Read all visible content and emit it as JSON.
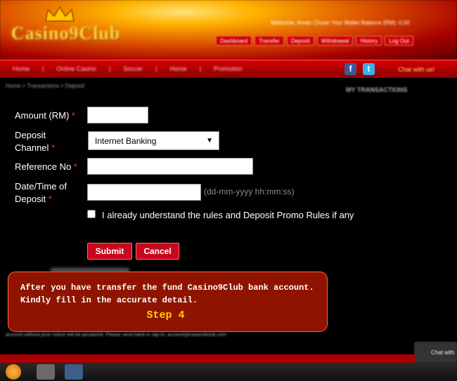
{
  "header": {
    "logo_text": "Casino9Club",
    "welcome": "Welcome, Aman Chuan   Your Wallet Balance (RM): 0.00",
    "buttons": [
      "Dashboard",
      "Transfer",
      "Deposit",
      "Withdrawal",
      "History",
      "Log Out"
    ]
  },
  "nav": {
    "items": [
      "Home",
      "|",
      "Online Casino",
      "|",
      "Soccer",
      "|",
      "Horse",
      "|",
      "Promotion"
    ],
    "facebook_icon": "f",
    "twitter_icon": "t",
    "chat": "Chat with us!"
  },
  "breadcrumb": "Home > Transactions > Deposit",
  "sidebar_title": "MY TRANSACTIONS",
  "form": {
    "amount_label": "Amount (RM)",
    "deposit_channel_label_1": "Deposit",
    "deposit_channel_label_2": "Channel",
    "deposit_channel_value": "Internet Banking",
    "reference_label": "Reference No",
    "datetime_label_1": "Date/Time of",
    "datetime_label_2": "Deposit",
    "datetime_hint": "(dd-mm-yyyy hh:mm:ss)",
    "required_mark": "*",
    "checkbox_label": "I already understand the rules and Deposit Promo Rules if any",
    "submit": "Submit",
    "cancel": "Cancel"
  },
  "tooltip": {
    "line1": "After you have transfer the fund Casino9Club bank account.",
    "line2": "Kindly fill in the accurate detail.",
    "step": "Step 4"
  },
  "footer_text": "account without prior notice will be penalized. Please send bank-in slip to: account@casino9club.com",
  "chat_widget": "Chat with",
  "colors": {
    "accent_red": "#c8081c",
    "tooltip_bg": "#8e1400",
    "step_yellow": "#ffd200",
    "required": "#ff2d2d"
  }
}
